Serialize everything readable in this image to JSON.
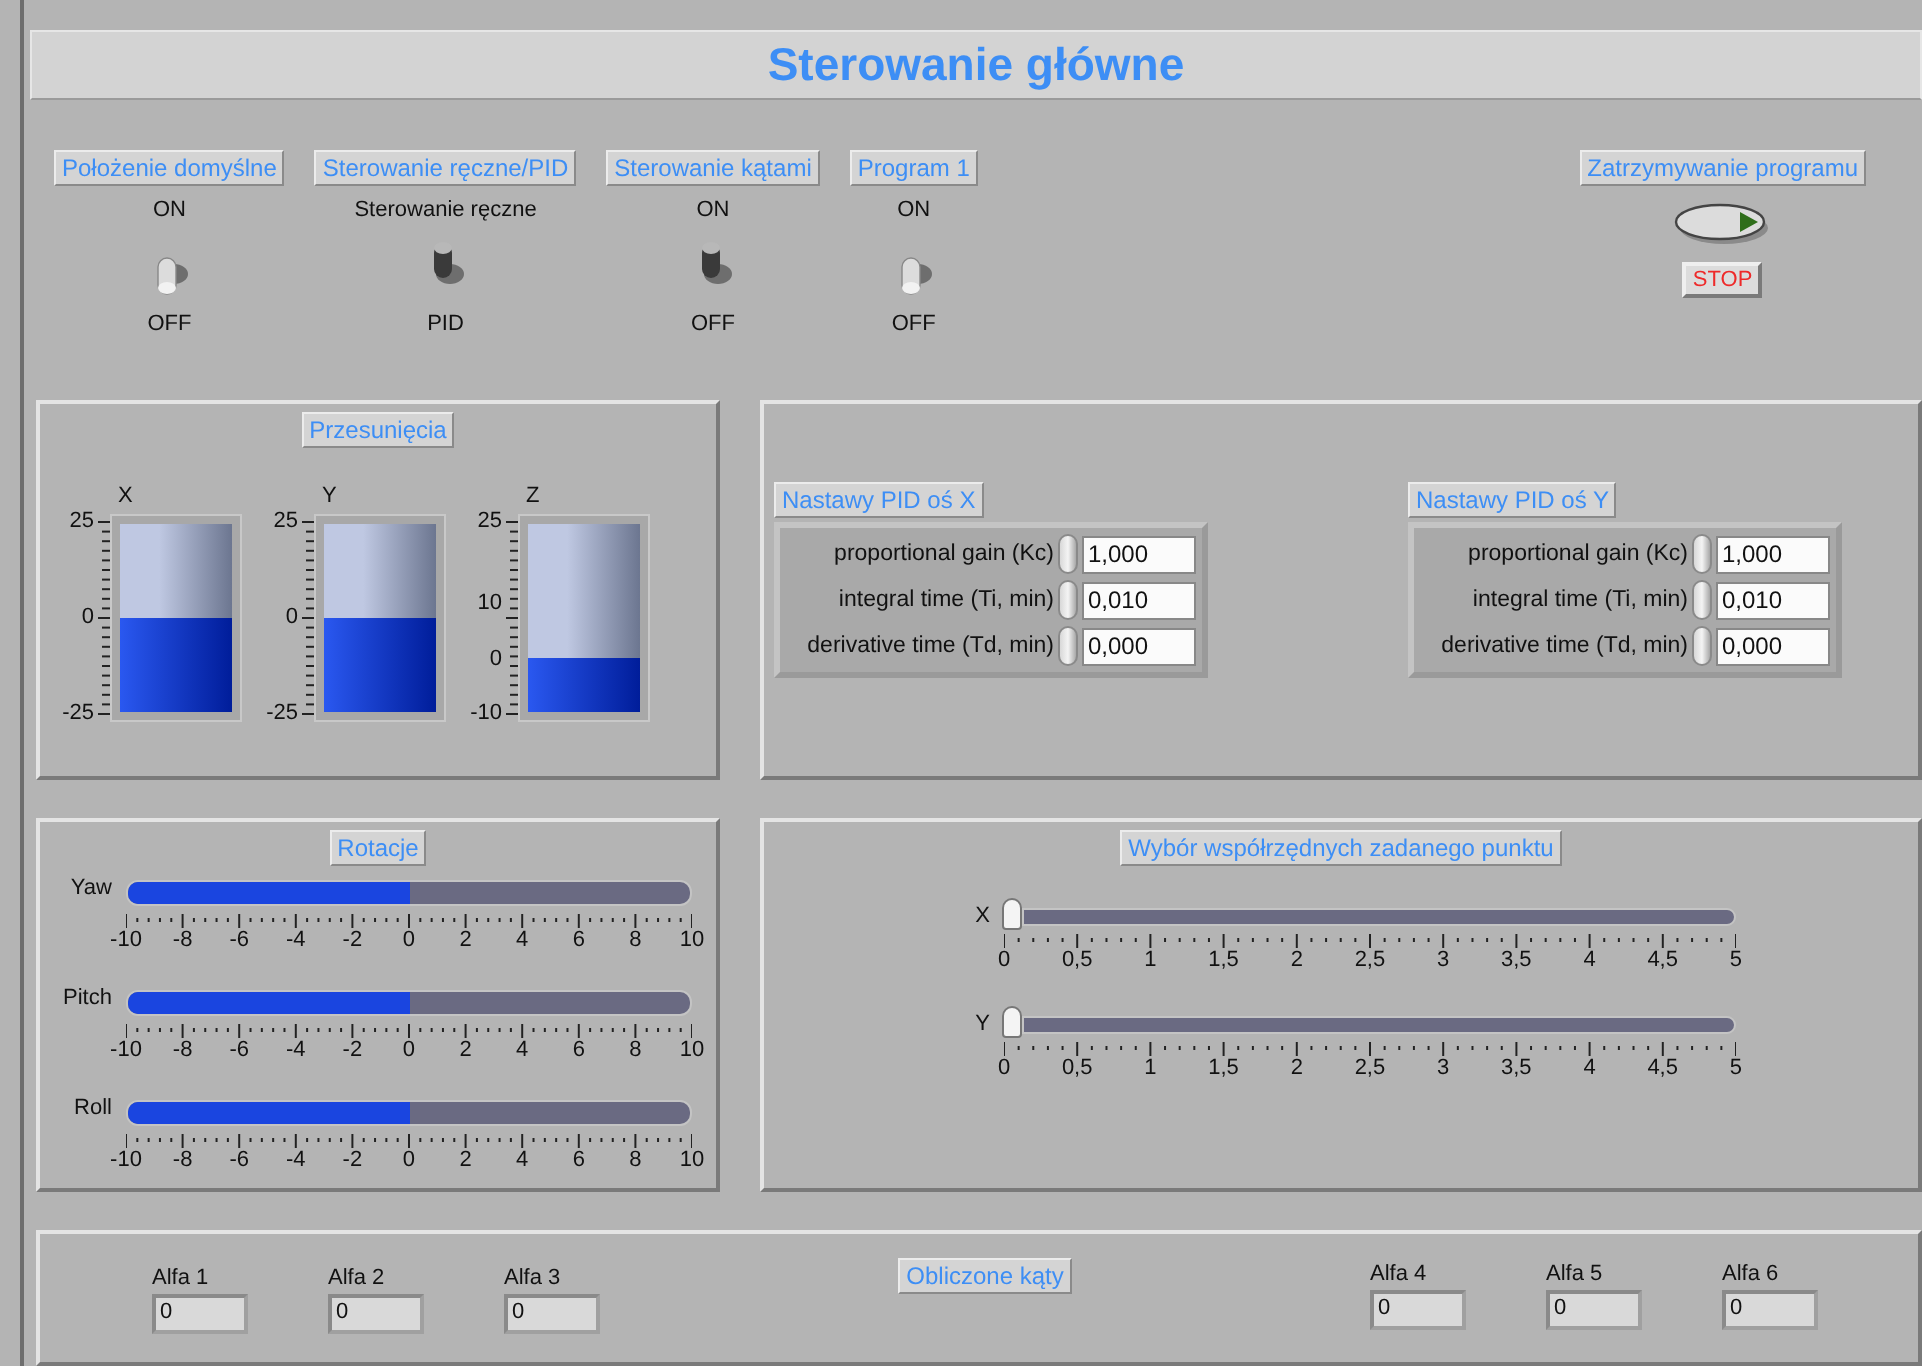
{
  "title": "Sterowanie główne",
  "switches": [
    {
      "label": "Położenie domyślne",
      "top_text": "ON",
      "bottom_text": "OFF",
      "on": false
    },
    {
      "label": "Sterowanie ręczne/PID",
      "top_text": "Sterowanie ręczne",
      "bottom_text": "PID",
      "on": true
    },
    {
      "label": "Sterowanie kątami",
      "top_text": "ON",
      "bottom_text": "OFF",
      "on": true
    },
    {
      "label": "Program 1",
      "top_text": "ON",
      "bottom_text": "OFF",
      "on": false
    }
  ],
  "stop": {
    "label": "Zatrzymywanie programu",
    "button": "STOP"
  },
  "displacement": {
    "title": "Przesunięcia",
    "tanks": [
      {
        "name": "X",
        "ticks": [
          "25",
          "0",
          "-25"
        ],
        "level": 0.5
      },
      {
        "name": "Y",
        "ticks": [
          "25",
          "0",
          "-25"
        ],
        "level": 0.5
      },
      {
        "name": "Z",
        "ticks": [
          "25",
          "10",
          "0",
          "-10"
        ],
        "level": 0.286
      }
    ]
  },
  "pid": [
    {
      "title": "Nastawy PID oś X",
      "params": [
        {
          "label": "proportional gain (Kc)",
          "value": "1,000"
        },
        {
          "label": "integral time (Ti, min)",
          "value": "0,010"
        },
        {
          "label": "derivative time (Td, min)",
          "value": "0,000"
        }
      ]
    },
    {
      "title": "Nastawy PID oś Y",
      "params": [
        {
          "label": "proportional gain (Kc)",
          "value": "1,000"
        },
        {
          "label": "integral time (Ti, min)",
          "value": "0,010"
        },
        {
          "label": "derivative time (Td, min)",
          "value": "0,000"
        }
      ]
    }
  ],
  "rotation": {
    "title": "Rotacje",
    "sliders": [
      {
        "name": "Yaw",
        "level": 0.5,
        "ticks": [
          "-10",
          "-8",
          "-6",
          "-4",
          "-2",
          "0",
          "2",
          "4",
          "6",
          "8",
          "10"
        ]
      },
      {
        "name": "Pitch",
        "level": 0.5,
        "ticks": [
          "-10",
          "-8",
          "-6",
          "-4",
          "-2",
          "0",
          "2",
          "4",
          "6",
          "8",
          "10"
        ]
      },
      {
        "name": "Roll",
        "level": 0.5,
        "ticks": [
          "-10",
          "-8",
          "-6",
          "-4",
          "-2",
          "0",
          "2",
          "4",
          "6",
          "8",
          "10"
        ]
      }
    ]
  },
  "setpoint": {
    "title": "Wybór współrzędnych zadanego punktu",
    "sliders": [
      {
        "name": "X",
        "level": 0,
        "ticks": [
          "0",
          "0,5",
          "1",
          "1,5",
          "2",
          "2,5",
          "3",
          "3,5",
          "4",
          "4,5",
          "5"
        ]
      },
      {
        "name": "Y",
        "level": 0,
        "ticks": [
          "0",
          "0,5",
          "1",
          "1,5",
          "2",
          "2,5",
          "3",
          "3,5",
          "4",
          "4,5",
          "5"
        ]
      }
    ]
  },
  "angles": {
    "title": "Obliczone kąty",
    "left_fields": [
      {
        "label": "Alfa 1",
        "value": "0"
      },
      {
        "label": "Alfa 2",
        "value": "0"
      },
      {
        "label": "Alfa 3",
        "value": "0"
      }
    ],
    "right_fields": [
      {
        "label": "Alfa 4",
        "value": "0"
      },
      {
        "label": "Alfa 5",
        "value": "0"
      },
      {
        "label": "Alfa 6",
        "value": "0"
      }
    ]
  }
}
